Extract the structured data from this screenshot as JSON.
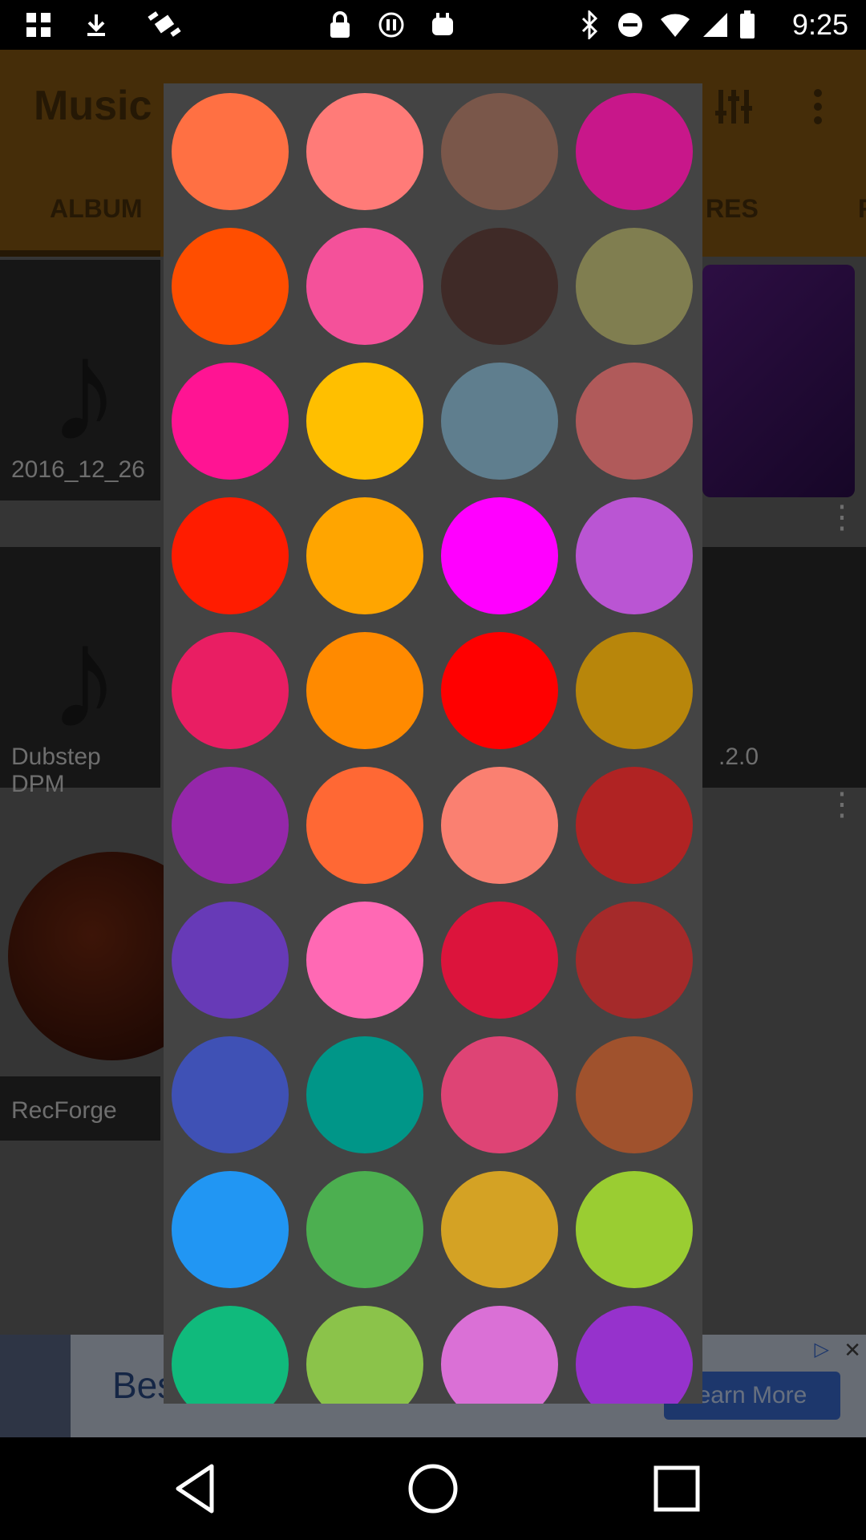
{
  "status_bar": {
    "time": "9:25",
    "icons_left": [
      "grid-icon",
      "download-icon",
      "fake-gps-icon",
      "lock-icon",
      "data-saver-icon",
      "notification-icon"
    ],
    "icons_right": [
      "bluetooth-icon",
      "do-not-disturb-icon",
      "wifi-icon",
      "signal-icon",
      "battery-icon"
    ]
  },
  "app": {
    "title": "Music P",
    "tabs": [
      "ALBUM",
      "RES",
      "F"
    ],
    "items": [
      {
        "label": "2016_12_26"
      },
      {
        "label": "Dubstep DPM"
      },
      {
        "label": ".2.0"
      },
      {
        "label": "RecForge"
      }
    ]
  },
  "ad": {
    "text": "Bes",
    "button_label": "earn More"
  },
  "picker": {
    "colors": [
      "#FF7043",
      "#FF7B78",
      "#7A574A",
      "#C8178A",
      "#FF4E00",
      "#F4519A",
      "#3F2A27",
      "#807E50",
      "#FF1493",
      "#FFBF00",
      "#5F7E8E",
      "#B05A5A",
      "#FF1C00",
      "#FFA500",
      "#FF00FF",
      "#BA55D3",
      "#E91E63",
      "#FF8A00",
      "#FF0000",
      "#B8860B",
      "#9527AA",
      "#FF6834",
      "#FA8071",
      "#B02323",
      "#673AB7",
      "#FF69B4",
      "#DC143C",
      "#A52A2A",
      "#3F51B5",
      "#009688",
      "#DE4475",
      "#A0522D",
      "#2196F3",
      "#4CAF50",
      "#D4A224",
      "#9ACD32",
      "#10BA7C",
      "#8BC34A",
      "#DA70D6",
      "#9632CC"
    ]
  }
}
